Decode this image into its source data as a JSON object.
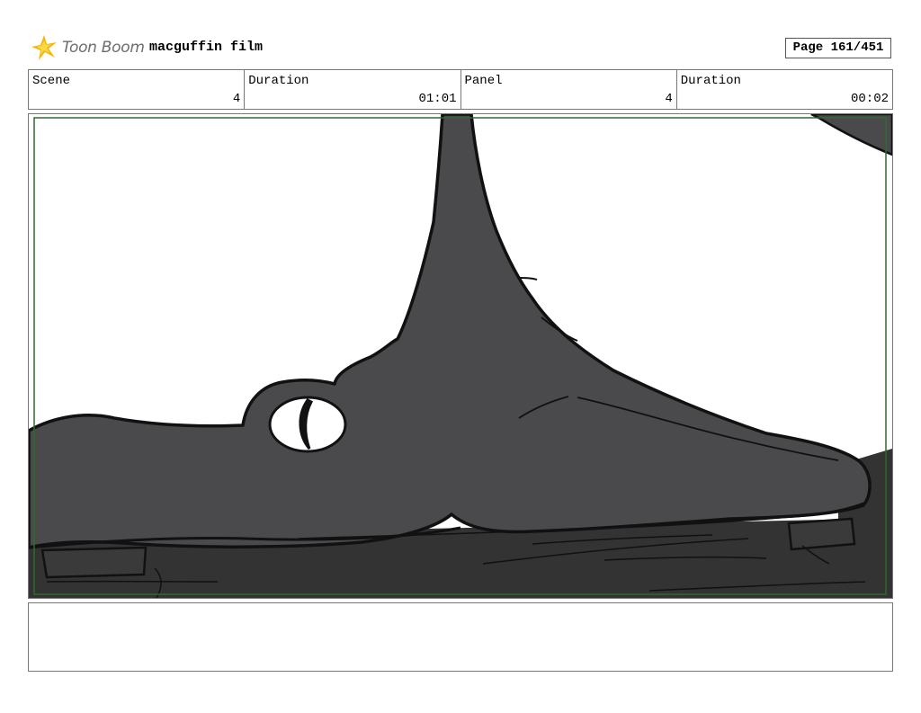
{
  "header": {
    "logo_text": "Toon Boom",
    "project_title": "macguffin film",
    "page_label": "Page 161/451"
  },
  "info": {
    "scene_label": "Scene",
    "scene_value": "4",
    "scene_duration_label": "Duration",
    "scene_duration_value": "01:01",
    "panel_label": "Panel",
    "panel_value": "4",
    "panel_duration_label": "Duration",
    "panel_duration_value": "00:02"
  },
  "colors": {
    "creature_fill": "#4a4a4c",
    "ground_fill": "#333333",
    "safe_frame": "#2e6b2e",
    "logo_accent": "#f5b800"
  },
  "notes": {
    "text": ""
  }
}
